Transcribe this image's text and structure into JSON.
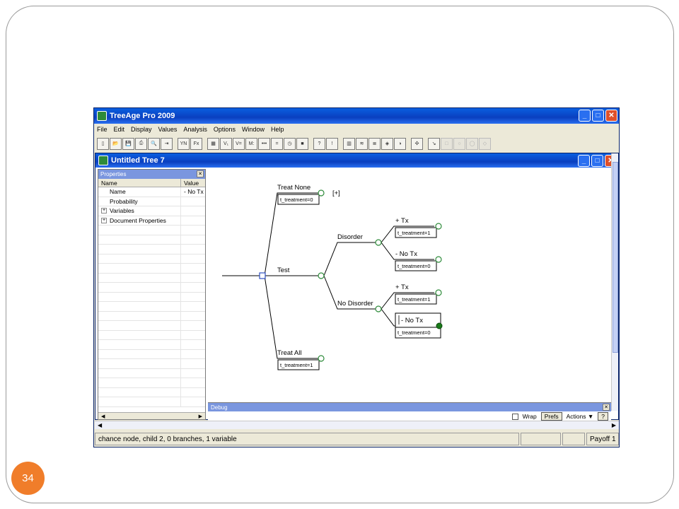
{
  "slide": {
    "number": "34"
  },
  "app": {
    "title": "TreeAge Pro 2009",
    "menu": [
      "File",
      "Edit",
      "Display",
      "Values",
      "Analysis",
      "Options",
      "Window",
      "Help"
    ],
    "toolbar": {
      "buttons": [
        {
          "name": "new-icon",
          "glyph": "▯"
        },
        {
          "name": "open-icon",
          "glyph": "📂"
        },
        {
          "name": "save-icon",
          "glyph": "💾"
        },
        {
          "name": "print-icon",
          "glyph": "⎙"
        },
        {
          "name": "print-preview-icon",
          "glyph": "🔍"
        },
        {
          "name": "export-icon",
          "glyph": "⇥"
        },
        {
          "name": "yn-icon",
          "glyph": "YN"
        },
        {
          "name": "function-icon",
          "glyph": "Fx"
        },
        {
          "name": "calculator-icon",
          "glyph": "▦"
        },
        {
          "name": "values-icon",
          "glyph": "V₁"
        },
        {
          "name": "variable-define-icon",
          "glyph": "V="
        },
        {
          "name": "markov-icon",
          "glyph": "M:"
        },
        {
          "name": "ellipsis-icon",
          "glyph": "•••"
        },
        {
          "name": "equals-icon",
          "glyph": "="
        },
        {
          "name": "clock-icon",
          "glyph": "◷"
        },
        {
          "name": "color-grid-icon",
          "glyph": "■"
        },
        {
          "name": "help-icon",
          "glyph": "?"
        },
        {
          "name": "warning-icon",
          "glyph": "!"
        },
        {
          "name": "bar-chart-icon",
          "glyph": "▥"
        },
        {
          "name": "sensitivity-icon",
          "glyph": "≋"
        },
        {
          "name": "sensitivity-2-icon",
          "glyph": "≣"
        },
        {
          "name": "cube-icon",
          "glyph": "◈"
        },
        {
          "name": "color-wheel-icon",
          "glyph": "◑"
        },
        {
          "name": "move-icon",
          "glyph": "✣"
        },
        {
          "name": "arrow-icon",
          "glyph": "↘"
        },
        {
          "name": "square-node-icon",
          "glyph": "□"
        },
        {
          "name": "circle-node-icon",
          "glyph": "○"
        },
        {
          "name": "terminal-node-icon",
          "glyph": "◯"
        },
        {
          "name": "diamond-node-icon",
          "glyph": "◇"
        }
      ]
    },
    "document": {
      "title": "Untitled Tree 7",
      "properties": {
        "header": "Properties",
        "columns": {
          "name": "Name",
          "value": "Value"
        },
        "rows": [
          {
            "name": "Name",
            "value": "- No Tx",
            "expander": false
          },
          {
            "name": "Probability",
            "value": "",
            "expander": false
          },
          {
            "name": "Variables",
            "value": "",
            "expander": true
          },
          {
            "name": "Document Properties",
            "value": "",
            "expander": true
          }
        ]
      },
      "tree": {
        "branches": {
          "treat_none": "Treat None",
          "treat_none_collapsed": "[+]",
          "test": "Test",
          "treat_all": "Treat All",
          "disorder": "Disorder",
          "no_disorder": "No Disorder",
          "plus_tx_1": "+ Tx",
          "minus_tx_1": "- No Tx",
          "plus_tx_2": "+ Tx",
          "minus_tx_2": "- No Tx"
        },
        "payoffs": {
          "treat_none": "t_treatment=0",
          "plus_tx_1": "t_treatment=1",
          "minus_tx_1": "t_treatment=0",
          "plus_tx_2": "t_treatment=1",
          "minus_tx_2": "t_treatment=0",
          "treat_all": "t_treatment=1"
        }
      },
      "debug": {
        "header": "Debug",
        "wrap_label": "Wrap",
        "prefs_label": "Prefs",
        "actions_label": "Actions ▼",
        "help_label": "?"
      }
    },
    "status": {
      "message": "chance node, child 2, 0 branches, 1 variable",
      "payoff": "Payoff 1"
    },
    "colors": {
      "titlebar": "#0a3fbf",
      "node_green": "#2e8b3a",
      "decision_node": "#3050c0"
    }
  }
}
